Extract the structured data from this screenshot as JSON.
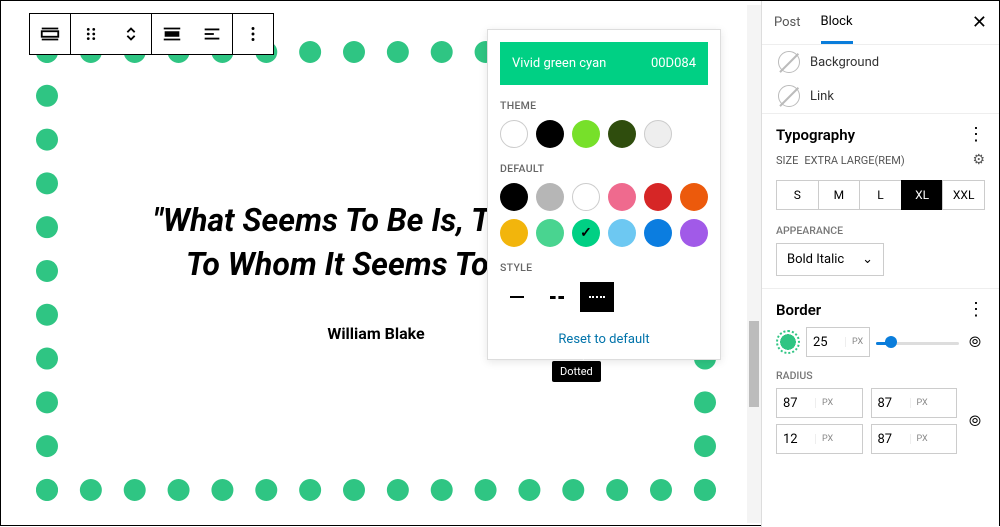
{
  "toolbar": {},
  "quote": {
    "line1": "\"What Seems To Be Is, To Those",
    "line2": "To Whom It Seems To Be...\"",
    "cite": "William Blake"
  },
  "popover": {
    "color_name": "Vivid green cyan",
    "color_hex": "00D084",
    "theme_label": "THEME",
    "default_label": "DEFAULT",
    "style_label": "STYLE",
    "reset": "Reset to default",
    "tooltip": "Dotted",
    "theme_colors": [
      "#ffffff",
      "#000000",
      "#77e02a",
      "#2f4d0d",
      "#eeeeee"
    ],
    "default_colors_row1": [
      "#000000",
      "#b6b6b6",
      "#ffffff",
      "#ef6a8e",
      "#d62626",
      "#ec5a0c"
    ],
    "default_colors_row2": [
      "#f2b50c",
      "#49d490",
      "#00D084",
      "#6dc8f2",
      "#0b7de0",
      "#a15ae8"
    ],
    "selected_default_index": 8
  },
  "sidebar": {
    "tabs": {
      "post": "Post",
      "block": "Block"
    },
    "background": "Background",
    "link": "Link",
    "typography": {
      "title": "Typography",
      "size_label": "SIZE",
      "size_name": "EXTRA LARGE(REM)",
      "sizes": [
        "S",
        "M",
        "L",
        "XL",
        "XXL"
      ],
      "active_size": "XL",
      "appearance_label": "APPEARANCE",
      "appearance_value": "Bold Italic"
    },
    "border": {
      "title": "Border",
      "width": "25",
      "unit": "PX",
      "radius_label": "RADIUS",
      "radius_values": [
        "87",
        "87",
        "12",
        "87"
      ]
    }
  }
}
